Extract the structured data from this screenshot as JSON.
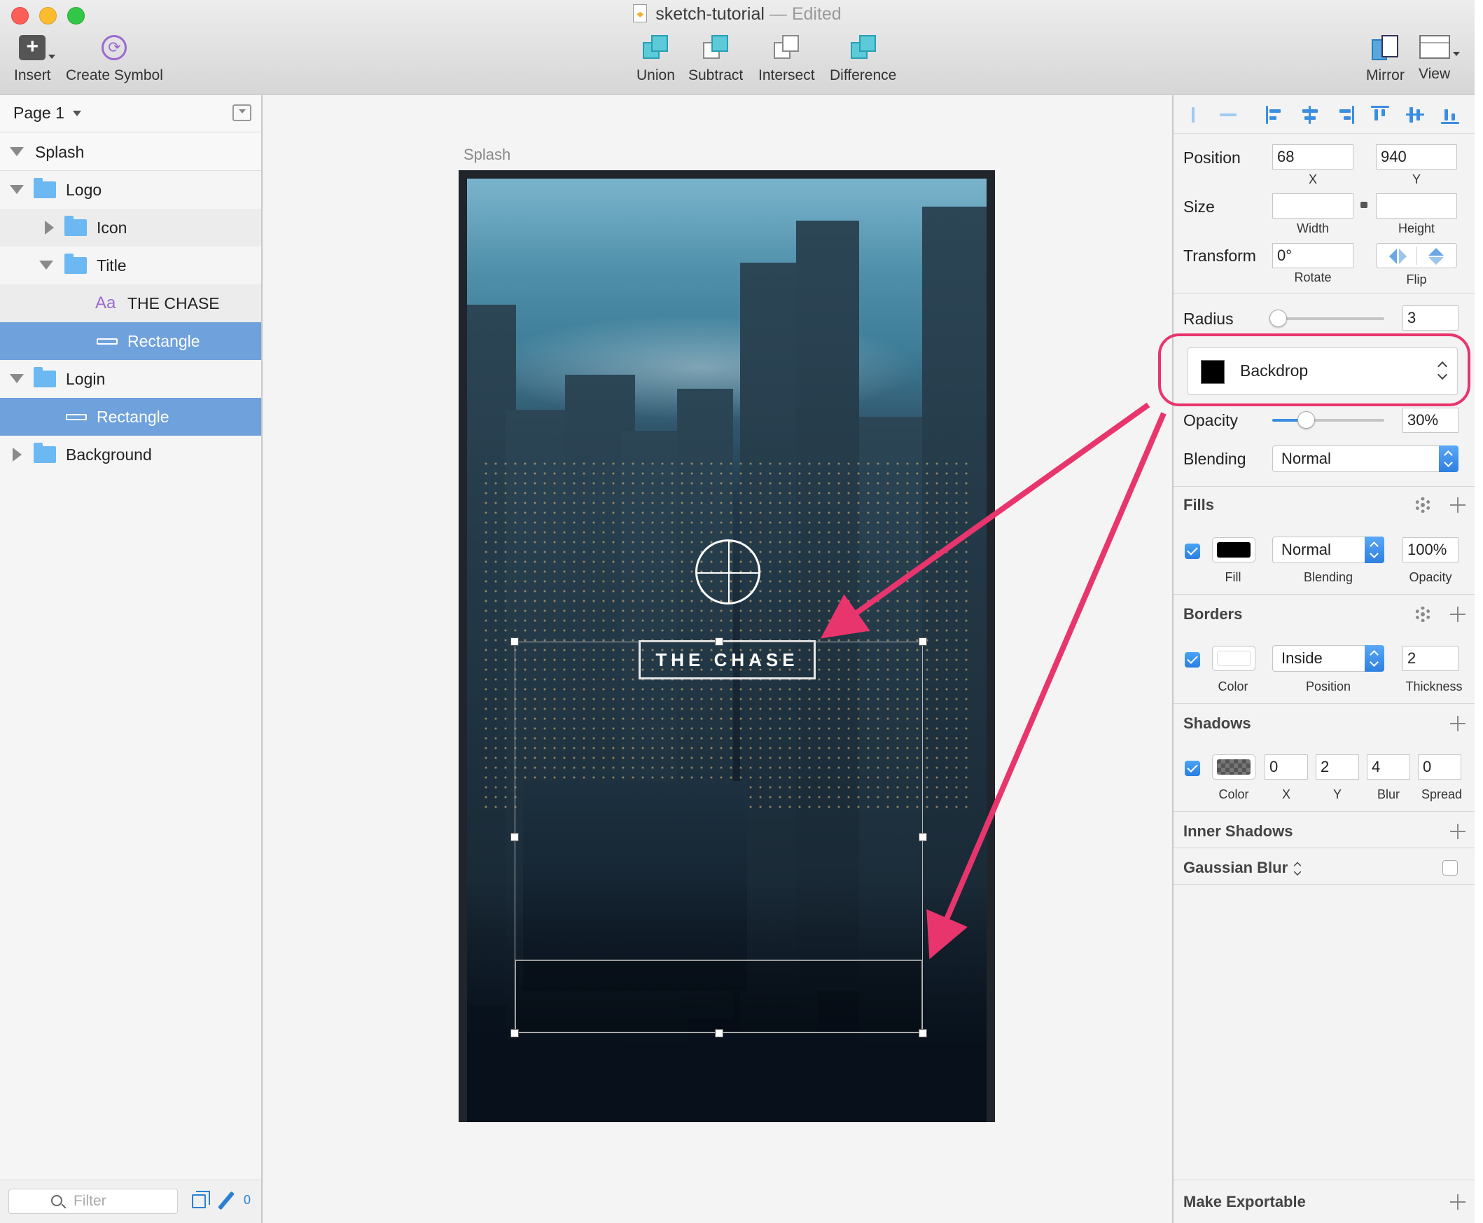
{
  "window": {
    "title": "sketch-tutorial",
    "title_sep": "—",
    "status": "Edited"
  },
  "toolbar": {
    "insert": "Insert",
    "create_symbol": "Create Symbol",
    "union": "Union",
    "subtract": "Subtract",
    "intersect": "Intersect",
    "difference": "Difference",
    "mirror": "Mirror",
    "view": "View"
  },
  "layers": {
    "page": "Page 1",
    "artboard": "Splash",
    "items": [
      {
        "label": "Logo"
      },
      {
        "label": "Icon"
      },
      {
        "label": "Title"
      },
      {
        "label": "THE CHASE"
      },
      {
        "label": "Rectangle"
      },
      {
        "label": "Login"
      },
      {
        "label": "Rectangle"
      },
      {
        "label": "Background"
      }
    ],
    "text_icon": "Aa",
    "filter_placeholder": "Filter",
    "pen_count": "0"
  },
  "canvas": {
    "artboard_label": "Splash",
    "title_text": "THE CHASE"
  },
  "inspector": {
    "position_label": "Position",
    "x": "68",
    "y": "940",
    "x_label": "X",
    "y_label": "Y",
    "size_label": "Size",
    "width": "",
    "height": "",
    "width_label": "Width",
    "height_label": "Height",
    "transform_label": "Transform",
    "rotate": "0°",
    "rotate_label": "Rotate",
    "flip_label": "Flip",
    "radius_label": "Radius",
    "radius": "3",
    "radius_slider_fraction": 0.05,
    "style": "Backdrop",
    "opacity_label": "Opacity",
    "opacity": "30%",
    "opacity_slider_fraction": 0.3,
    "blending_label": "Blending",
    "blending": "Normal",
    "fills": {
      "title": "Fills",
      "color": "#000000",
      "blending": "Normal",
      "opacity": "100%",
      "fill_label": "Fill",
      "blending_label": "Blending",
      "opacity_label": "Opacity"
    },
    "borders": {
      "title": "Borders",
      "color": "#ffffff",
      "position": "Inside",
      "thickness": "2",
      "color_label": "Color",
      "position_label": "Position",
      "thickness_label": "Thickness"
    },
    "shadows": {
      "title": "Shadows",
      "x": "0",
      "y": "2",
      "blur": "4",
      "spread": "0",
      "color_label": "Color",
      "x_label": "X",
      "y_label": "Y",
      "blur_label": "Blur",
      "spread_label": "Spread"
    },
    "inner_shadows": "Inner Shadows",
    "gaussian_blur": "Gaussian Blur",
    "make_exportable": "Make Exportable"
  },
  "colors": {
    "accent": "#3a8ee0",
    "annotation": "#e8356d",
    "selection": "#6fa1dc"
  }
}
